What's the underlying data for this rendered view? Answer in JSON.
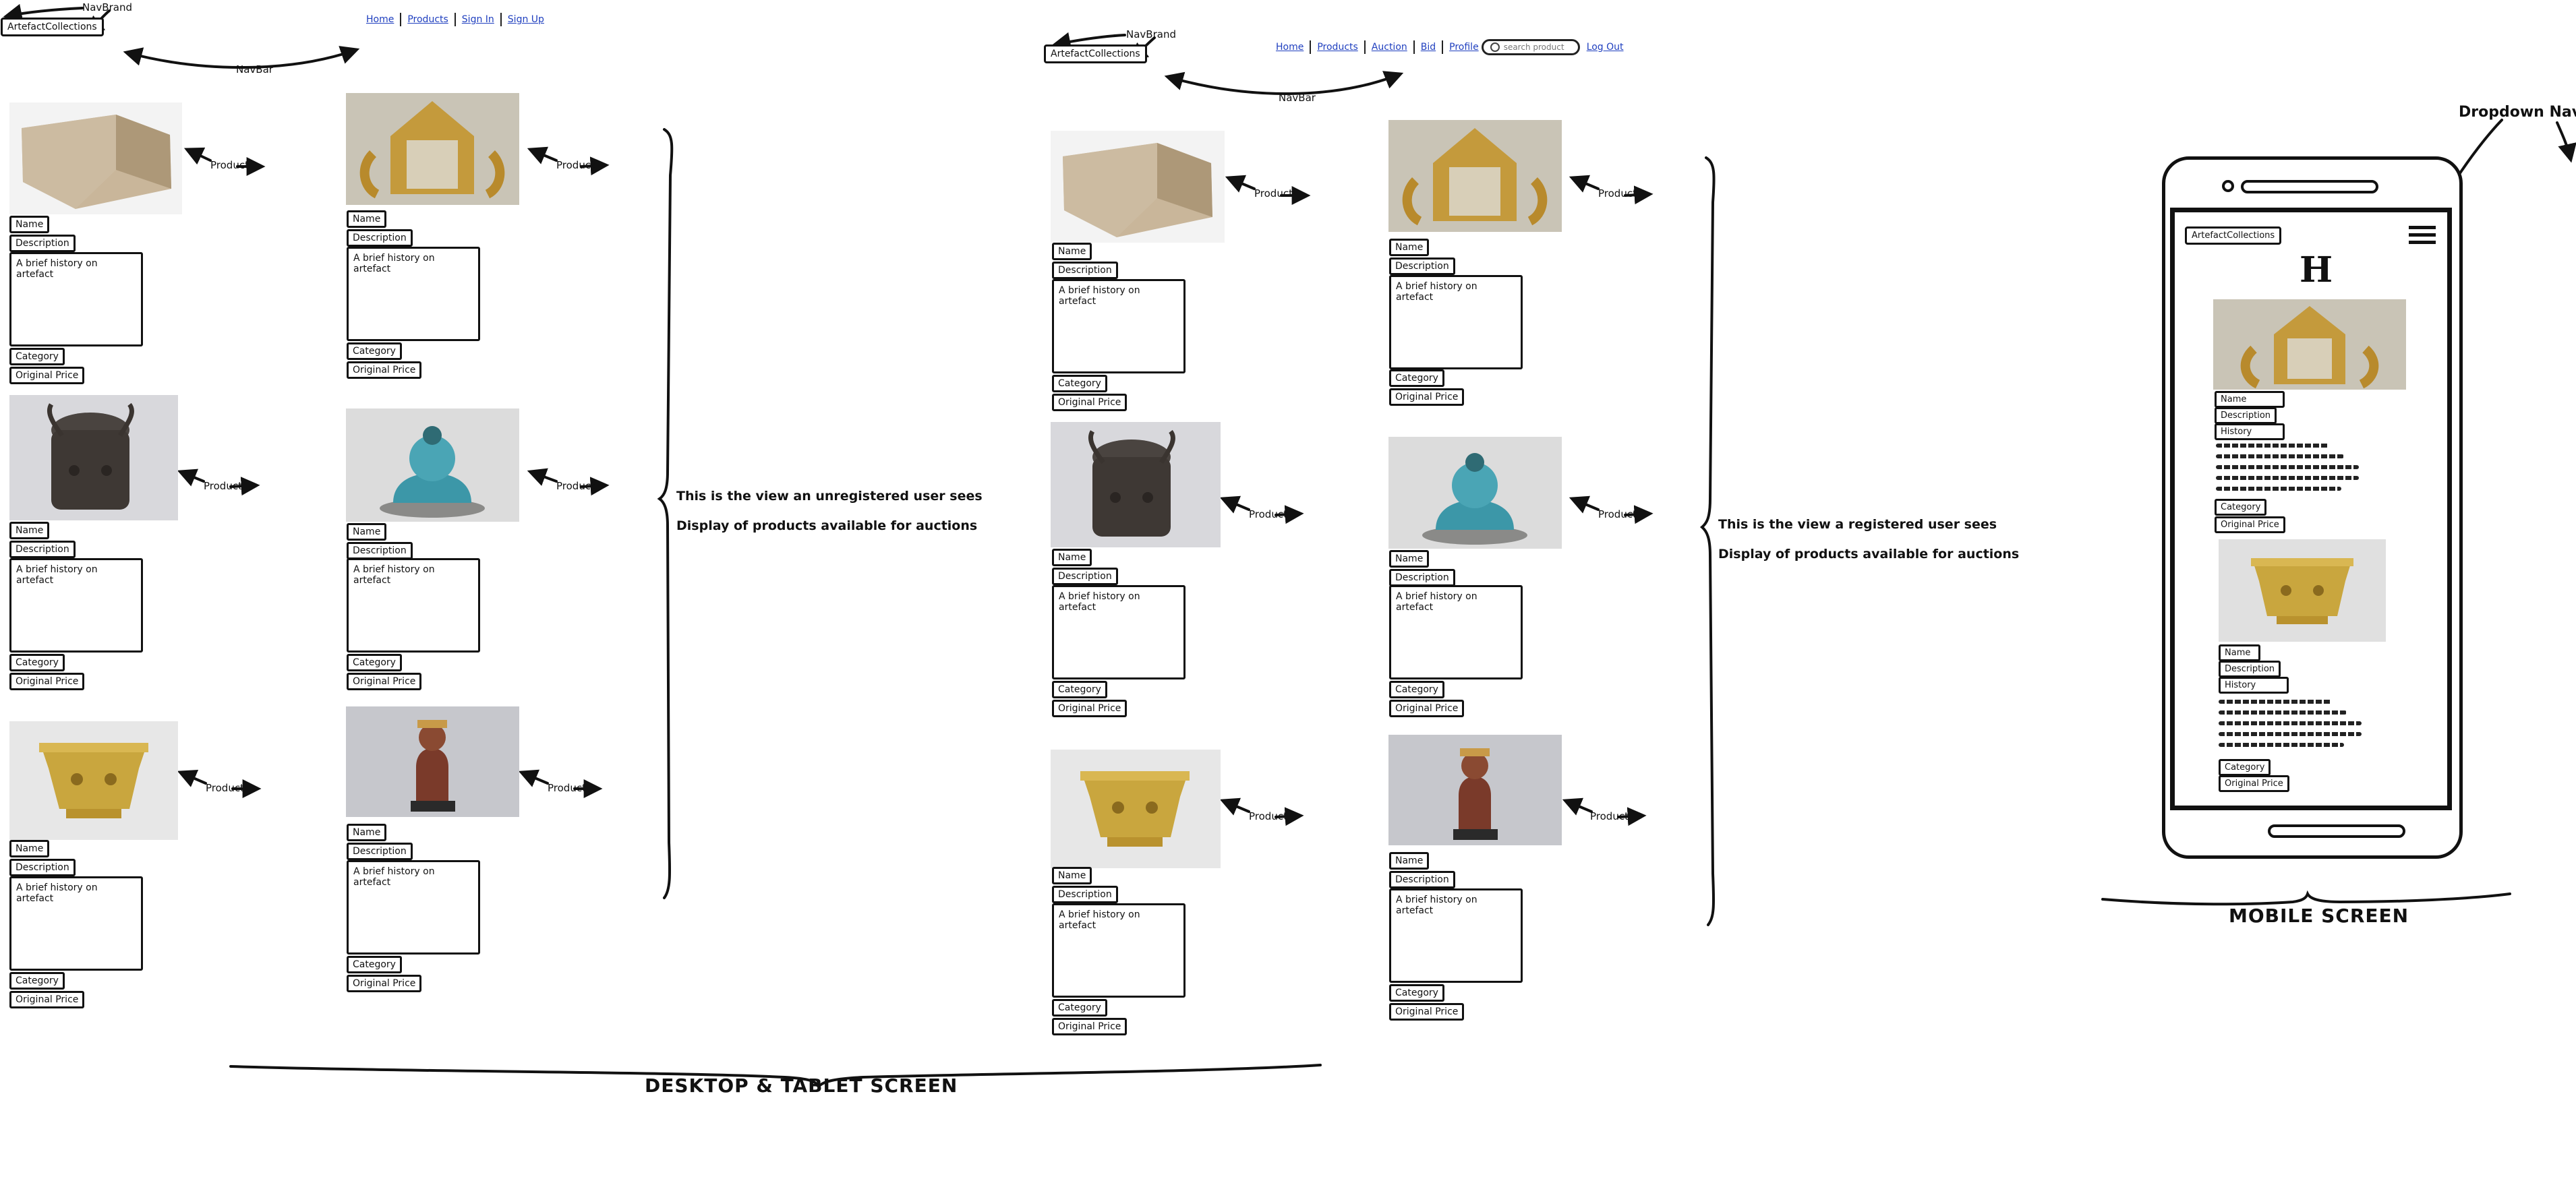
{
  "annotations": {
    "navbrand": "NavBrand",
    "navbar": "NavBar",
    "product": "Product",
    "dropdown_nav": "Dropdown Nav"
  },
  "brand": "ArtefactCollections",
  "unregistered_nav": [
    "Home",
    "Products",
    "Sign In",
    "Sign Up"
  ],
  "registered_nav": [
    "Home",
    "Products",
    "Auction",
    "Bid",
    "Profile"
  ],
  "logout": "Log Out",
  "search_placeholder": "search product",
  "card": {
    "name": "Name",
    "description": "Description",
    "history": "A brief history on artefact",
    "category": "Category",
    "price": "Original Price"
  },
  "notes": {
    "unregistered_1": "This is the view an unregistered user sees",
    "unregistered_2": "Display of products available for auctions",
    "registered_1": "This is the view a registered user sees",
    "registered_2": "Display of products available for auctions"
  },
  "screen_labels": {
    "desktop": "DESKTOP & TABLET SCREEN",
    "mobile": "MOBILE SCREEN"
  },
  "mobile": {
    "brand": "ArtefactCollections",
    "heading": "H",
    "name": "Name",
    "description": "Description",
    "history": "History",
    "category": "Category",
    "price": "Original Price"
  },
  "artefacts": [
    "stone-box",
    "golden-frame",
    "bronze-head",
    "turquoise-buddha",
    "gold-vessel",
    "carved-figure"
  ],
  "colors": {
    "link": "#1f3fbf",
    "ink": "#111111"
  }
}
